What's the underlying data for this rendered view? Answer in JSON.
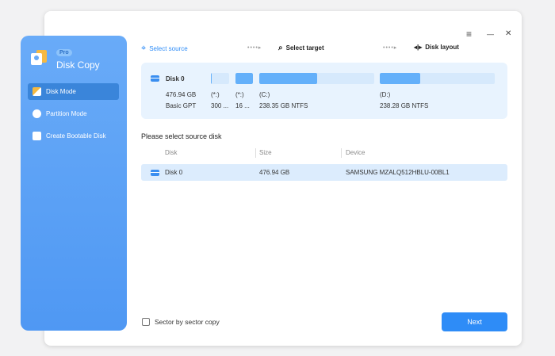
{
  "window": {
    "menu_icon": "≡",
    "minimize_icon": "—",
    "close_icon": "✕"
  },
  "sidebar": {
    "badge": "Pro",
    "app_name": "Disk Copy",
    "items": [
      {
        "label": "Disk Mode",
        "active": true
      },
      {
        "label": "Partition Mode"
      },
      {
        "label": "Create Bootable Disk"
      }
    ]
  },
  "steps": [
    {
      "label": "Select source",
      "active": true
    },
    {
      "label": "Select target"
    },
    {
      "label": "Disk layout"
    }
  ],
  "disk_panel": {
    "name": "Disk 0",
    "size": "476.94 GB",
    "type": "Basic GPT",
    "partitions": [
      {
        "label": "(*:)",
        "info": "300 ...",
        "used": 0.05
      },
      {
        "label": "(*:)",
        "info": "16 ...",
        "used": 1.0
      },
      {
        "label": "(C:)",
        "info": "238.35 GB NTFS",
        "used": 0.5
      },
      {
        "label": "(D:)",
        "info": "238.28 GB NTFS",
        "used": 0.35
      }
    ]
  },
  "source": {
    "title": "Please select source disk",
    "columns": [
      "Disk",
      "Size",
      "Device"
    ],
    "rows": [
      {
        "disk": "Disk 0",
        "size": "476.94 GB",
        "device": "SAMSUNG MZALQ512HBLU-00BL1"
      }
    ]
  },
  "footer": {
    "sector_copy": "Sector by sector copy",
    "next": "Next"
  }
}
